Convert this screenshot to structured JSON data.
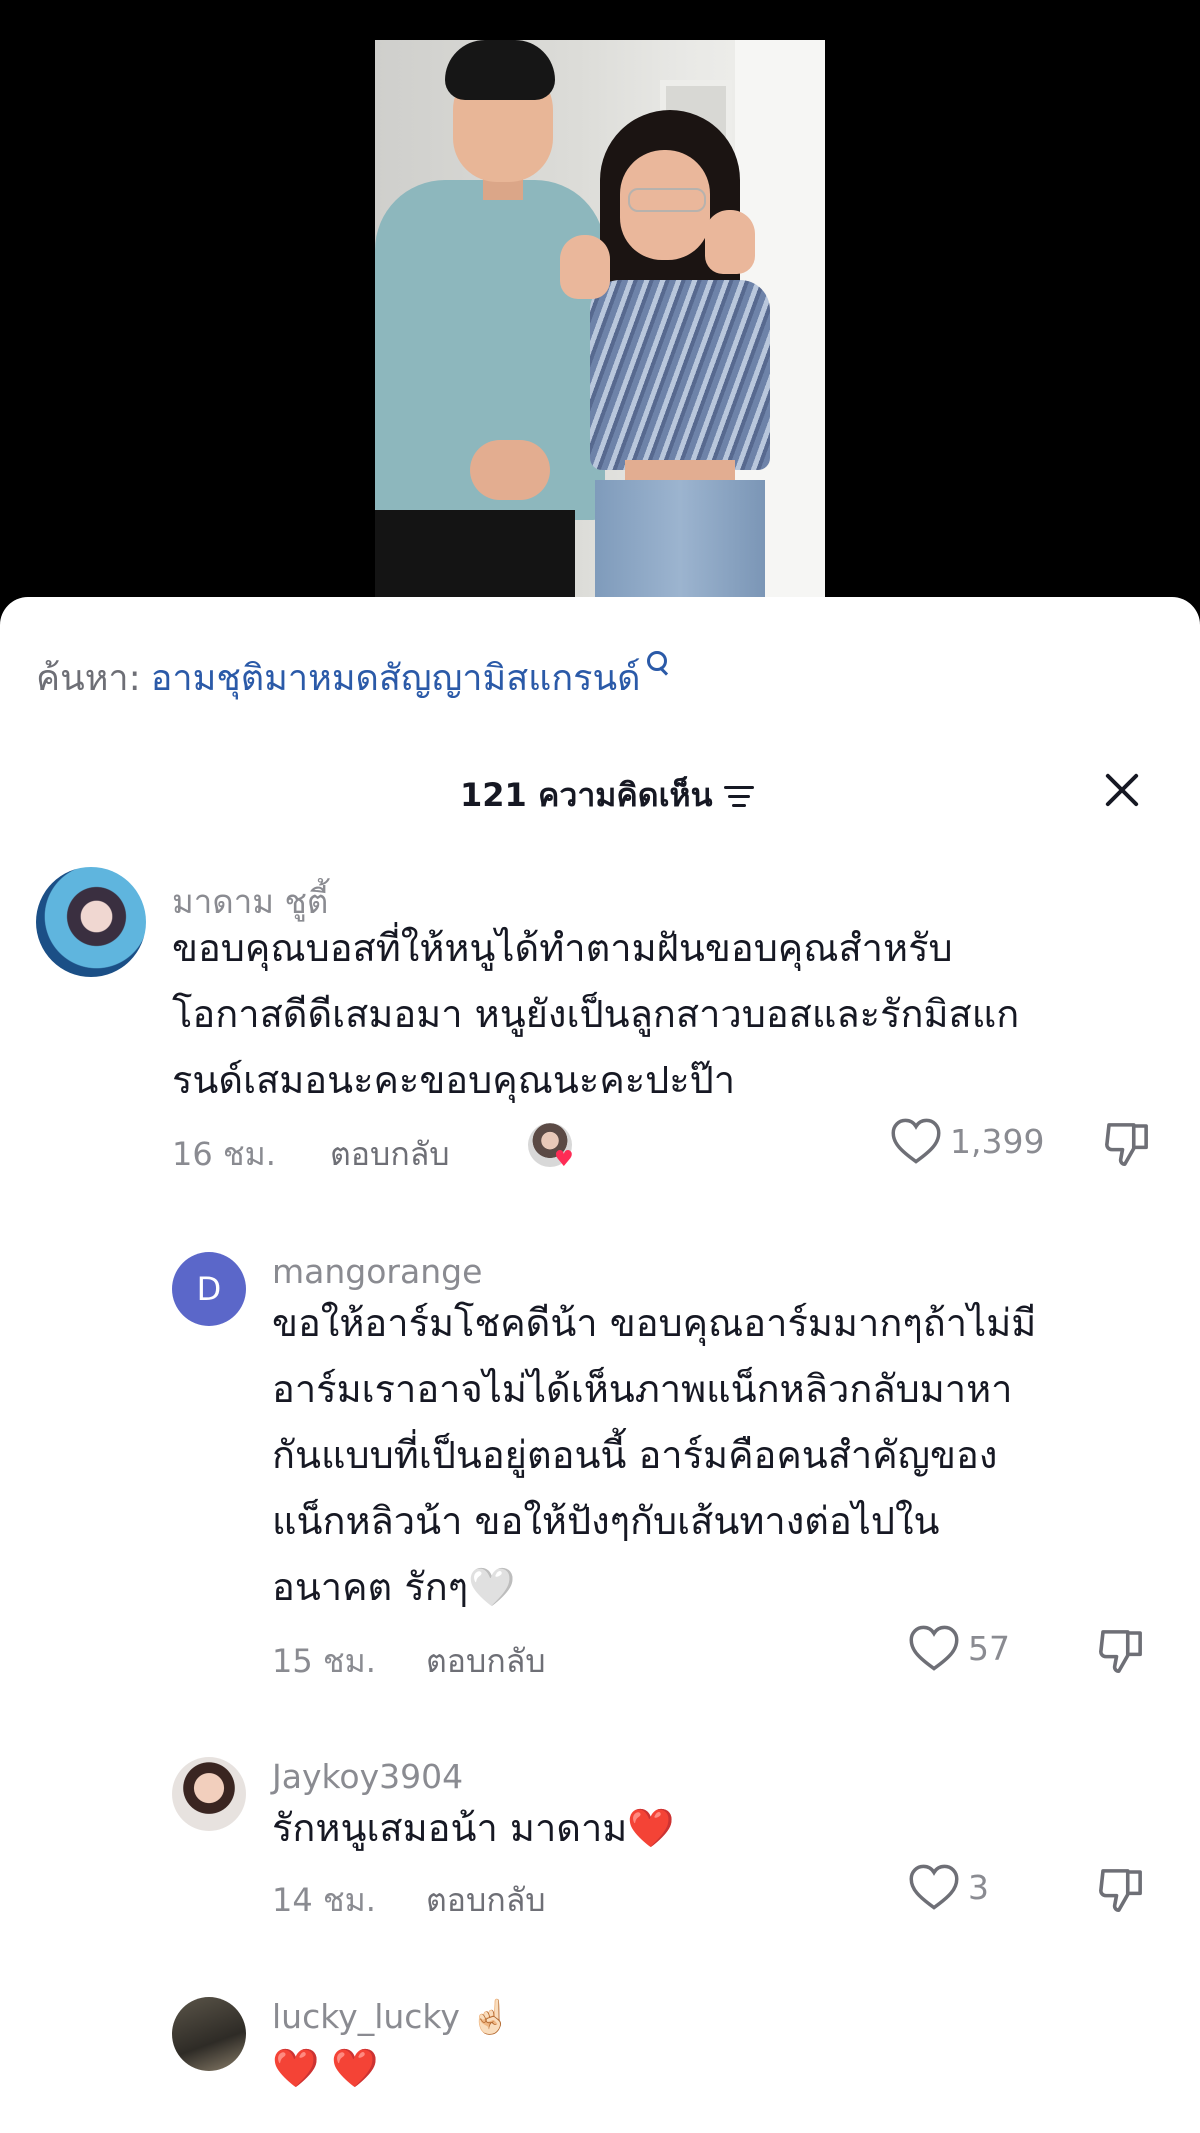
{
  "search": {
    "label": "ค้นหา:",
    "query": "อามชุติมาหมดสัญญามิสแกรนด์"
  },
  "header": {
    "comment_count": "121 ความคิดเห็น"
  },
  "comments": [
    {
      "username": "มาดาม ชูตี้",
      "lines": [
        "ขอบคุณบอสที่ให้หนูได้ทำตามฝันขอบคุณสำหรับ",
        "โอกาสดีดีเสมอมา หนูยังเป็นลูกสาวบอสและรักมิสแก",
        "รนด์เสมอนะคะขอบคุณนะคะปะป๊า"
      ],
      "time": "16 ชม.",
      "reply_label": "ตอบกลับ",
      "likes": "1,399"
    },
    {
      "username": "mangorange",
      "avatar_letter": "D",
      "lines": [
        "ขอให้อาร์มโชคดีน้า ขอบคุณอาร์มมากๆถ้าไม่มี",
        "อาร์มเราอาจไม่ได้เห็นภาพแน็กหลิวกลับมาหา",
        "กันแบบที่เป็นอยู่ตอนนี้ อาร์มคือคนสำคัญของ",
        "แน็กหลิวน้า ขอให้ปังๆกับเส้นทางต่อไปใน",
        "อนาคต รักๆ🤍"
      ],
      "time": "15 ชม.",
      "reply_label": "ตอบกลับ",
      "likes": "57"
    },
    {
      "username": "Jaykoy3904",
      "lines": [
        "รักหนูเสมอน้า มาดาม❤️"
      ],
      "time": "14 ชม.",
      "reply_label": "ตอบกลับ",
      "likes": "3"
    },
    {
      "username": "lucky_lucky ☝🏻",
      "lines": [
        "❤️ ❤️"
      ]
    }
  ],
  "colors": {
    "like_heart": "#fe2c55",
    "search_link": "#2b5aa8",
    "avatar_d": "#5b67c9"
  }
}
